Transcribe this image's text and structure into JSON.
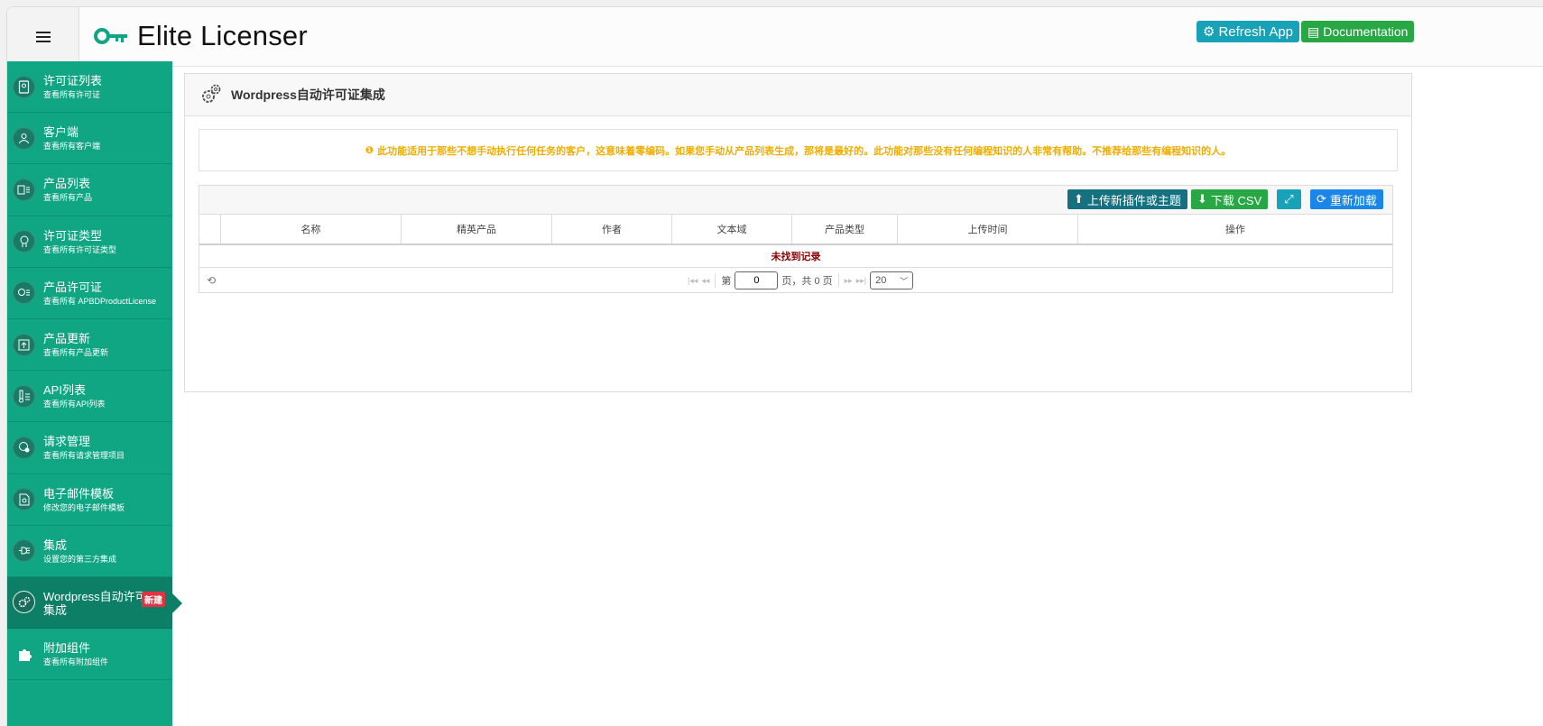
{
  "app": {
    "title": "Elite Licenser",
    "buttons": {
      "refresh": "Refresh App",
      "docs": "Documentation"
    }
  },
  "sidebar": {
    "items": [
      {
        "label": "许可证列表",
        "sub": "查看所有许可证",
        "icon": "license-icon"
      },
      {
        "label": "客户端",
        "sub": "查看所有客户端",
        "icon": "clients-icon"
      },
      {
        "label": "产品列表",
        "sub": "查看所有产品",
        "icon": "products-icon"
      },
      {
        "label": "许可证类型",
        "sub": "查看所有许可证类型",
        "icon": "license-type-icon"
      },
      {
        "label": "产品许可证",
        "sub": "查看所有 APBDProductLicense",
        "icon": "product-license-icon"
      },
      {
        "label": "产品更新",
        "sub": "查看所有产品更新",
        "icon": "product-update-icon"
      },
      {
        "label": "API列表",
        "sub": "查看所有API列表",
        "icon": "api-icon"
      },
      {
        "label": "请求管理",
        "sub": "查看所有请求管理项目",
        "icon": "request-icon"
      },
      {
        "label": "电子邮件模板",
        "sub": "修改您的电子邮件模板",
        "icon": "email-icon"
      },
      {
        "label": "集成",
        "sub": "设置您的第三方集成",
        "icon": "plug-icon"
      },
      {
        "label": "Wordpress自动许可",
        "label2": "集成",
        "badge": "新建",
        "icon": "gears-icon",
        "active": true
      },
      {
        "label": "附加组件",
        "sub": "查看所有附加组件",
        "icon": "puzzle-icon"
      }
    ]
  },
  "main": {
    "title": "Wordpress自动许可证集成",
    "notice": "此功能适用于那些不想手动执行任何任务的客户，这意味着零编码。如果您手动从产品列表生成，那将是最好的。此功能对那些没有任何编程知识的人非常有帮助。不推荐给那些有编程知识的人。",
    "toolbar": {
      "upload": "上传新插件或主题",
      "csv": "下载 CSV",
      "reload": "重新加载"
    },
    "columns": [
      "名称",
      "精英产品",
      "作者",
      "文本域",
      "产品类型",
      "上传时间",
      "操作"
    ],
    "empty": "未找到记录",
    "pager": {
      "page_prefix": "第",
      "page_value": "0",
      "page_suffix": "页，共 0 页",
      "page_size": "20"
    }
  },
  "colors": {
    "sidebar": "#10a683",
    "sidebar_active": "#0c7f66",
    "notice": "#f0ad00",
    "empty_text": "#8b0000"
  }
}
